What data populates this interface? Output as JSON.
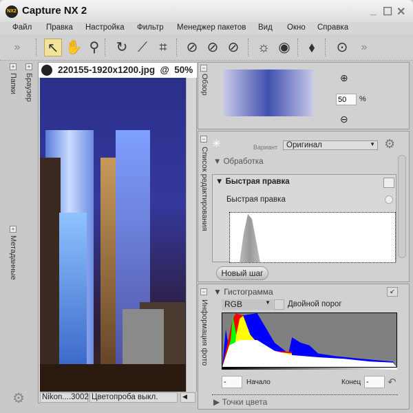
{
  "app": {
    "title": "Capture NX 2",
    "logo": "NX2"
  },
  "menu": [
    "Файл",
    "Правка",
    "Настройка",
    "Фильтр",
    "Менеджер пакетов",
    "Вид",
    "Окно",
    "Справка"
  ],
  "toolbar": {
    "tools": [
      "more-icon",
      "direct-select-icon",
      "hand-icon",
      "zoom-icon",
      "rotate-icon",
      "straighten-icon",
      "crop-icon",
      "black-point-icon",
      "neutral-point-icon",
      "white-point-icon",
      "red-eye-icon",
      "eye-icon",
      "auto-retouch-icon",
      "control-point-icon",
      "more-icon"
    ],
    "active_tool": "direct-select-icon"
  },
  "left_panel": {
    "tabs": [
      "Папки",
      "Браузер",
      "Метаданные"
    ]
  },
  "document": {
    "tab_title": "220155-1920x1200.jpg  @  50%  |",
    "status_camera": "Nikon....3002",
    "softproof": "Цветопроба выкл."
  },
  "overview": {
    "label": "Обзор",
    "zoom_value": "50",
    "zoom_unit": "%"
  },
  "edit_list": {
    "label": "Список редактирования",
    "variant_label": "Вариант",
    "variant_value": "Оригинал",
    "section": "Обработка",
    "step_title": "Быстрая правка",
    "step_sub": "Быстрая правка",
    "new_step": "Новый шаг"
  },
  "histogram": {
    "panel_label": "Информация фото",
    "title": "Гистограмма",
    "channel": "RGB",
    "dual_threshold": "Двойной порог",
    "start_label": "Начало",
    "end_label": "Конец",
    "start_value": "-",
    "end_value": "-",
    "color_points": "Точки цвета"
  },
  "colors": {
    "accent": "#f1e39a",
    "panel": "#d1d1d1"
  }
}
